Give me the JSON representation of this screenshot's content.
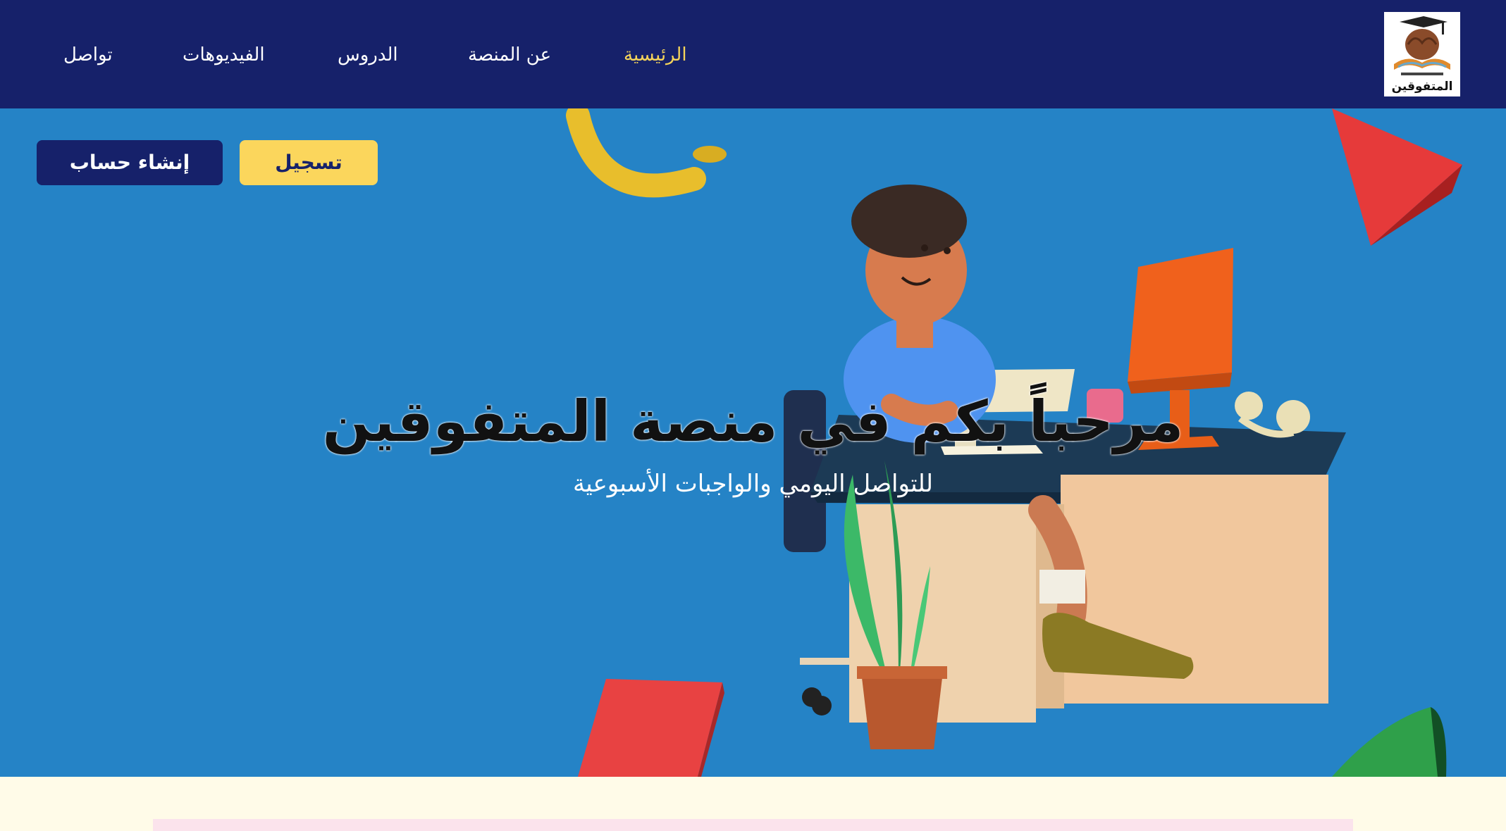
{
  "nav": {
    "logo_text": "المتفوقين",
    "links": [
      {
        "label": "الرئيسية",
        "active": true
      },
      {
        "label": "عن المنصة",
        "active": false
      },
      {
        "label": "الدروس",
        "active": false
      },
      {
        "label": "الفيديوهات",
        "active": false
      },
      {
        "label": "تواصل",
        "active": false
      }
    ]
  },
  "hero": {
    "title": "مرحباً بكم في منصة المتفوقين",
    "subtitle": "للتواصل اليومي والواجبات الأسبوعية",
    "register_button": "تسجيل",
    "create_account_button": "إنشاء حساب"
  },
  "colors": {
    "navbar": "#16216a",
    "hero_background": "#2583c6",
    "accent_yellow": "#fbd65c",
    "page_background": "#fffbe8"
  }
}
